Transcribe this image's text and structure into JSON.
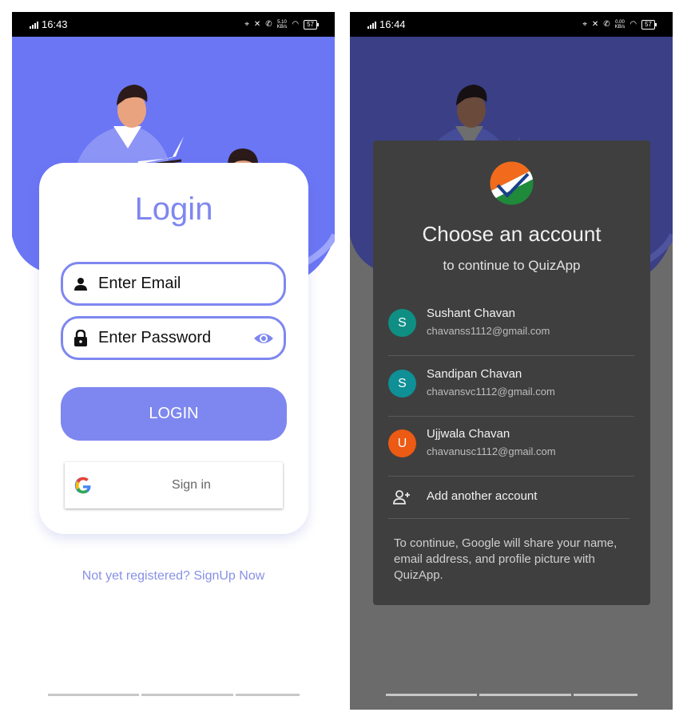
{
  "left_screen": {
    "status": {
      "time": "16:43",
      "speed_top": "5.10",
      "speed_bottom": "KB/s",
      "battery": "57"
    },
    "title": "Login",
    "email_placeholder": "Enter Email",
    "password_placeholder": "Enter Password",
    "login_button": "LOGIN",
    "google_button": "Sign in",
    "signup_link": "Not yet registered? SignUp Now"
  },
  "right_screen": {
    "status": {
      "time": "16:44",
      "speed_top": "0.00",
      "speed_bottom": "KB/s",
      "battery": "57"
    },
    "dialog": {
      "title": "Choose an account",
      "subtitle": "to continue to QuizApp",
      "accounts": [
        {
          "initial": "S",
          "name": "Sushant Chavan",
          "email": "chavanss1112@gmail.com",
          "color": "#0f8f84"
        },
        {
          "initial": "S",
          "name": "Sandipan Chavan",
          "email": "chavansvc1112@gmail.com",
          "color": "#0f8f96"
        },
        {
          "initial": "U",
          "name": "Ujjwala Chavan",
          "email": "chavanusc1112@gmail.com",
          "color": "#ec5a13"
        }
      ],
      "add_account": "Add another account",
      "note": "To continue, Google will share your name, email address, and profile picture with QuizApp."
    }
  },
  "colors": {
    "accent": "#7e87ef",
    "hero_blue": "#6b76f5",
    "dialog_bg": "#3f3f3f"
  }
}
